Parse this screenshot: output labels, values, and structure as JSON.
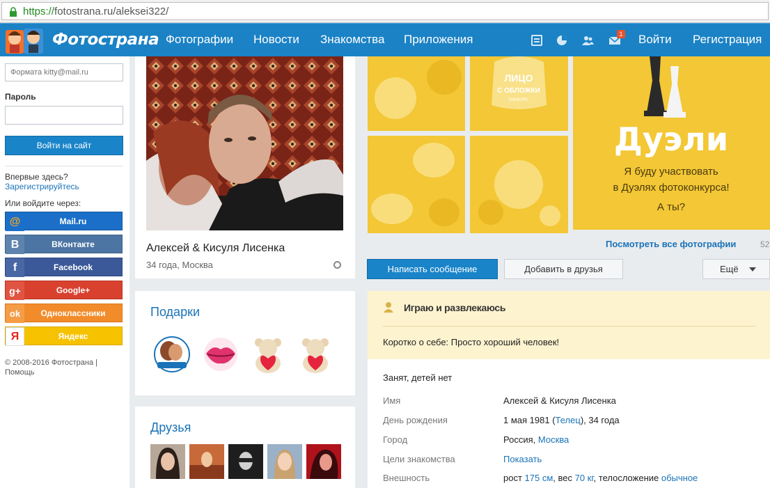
{
  "browser": {
    "url_scheme": "https://",
    "url_rest": "fotostrana.ru/aleksei322/"
  },
  "nav": {
    "logo_text": "Фотострана",
    "links": [
      "Фотографии",
      "Новости",
      "Знакомства",
      "Приложения"
    ],
    "icons": [
      "list-icon",
      "pie-icon",
      "people-icon",
      "mail-icon"
    ],
    "mail_badge": "1",
    "login": "Войти",
    "register": "Регистрация",
    "color": "#1b82c5"
  },
  "sidebar": {
    "email_placeholder": "Формата kitty@mail.ru",
    "password_label": "Пароль",
    "login_button": "Войти на сайт",
    "first_time": "Впервые здесь?",
    "register_link": "Зарегистрируйтесь",
    "or_login": "Или войдите через:",
    "social": [
      {
        "label": "Mail.ru",
        "icon": "@",
        "color": "#1b6fc8",
        "icon_bg": "#f5a623"
      },
      {
        "label": "ВКонтакте",
        "icon": "B",
        "color": "#4c75a3",
        "icon_bg": "#4c75a3"
      },
      {
        "label": "Facebook",
        "icon": "f",
        "color": "#3b5998",
        "icon_bg": "#3b5998"
      },
      {
        "label": "Google+",
        "icon": "g+",
        "color": "#d9412f",
        "icon_bg": "#d9412f"
      },
      {
        "label": "Одноклассники",
        "icon": "ok",
        "color": "#f28c2b",
        "icon_bg": "#f28c2b"
      },
      {
        "label": "Яндекс",
        "icon": "Я",
        "color": "#f6c200",
        "icon_bg": "#ffffff"
      }
    ],
    "copyright": "© 2008-2016 Фотострана | Помощь"
  },
  "profile": {
    "name": "Алексей & Кисуля Лисенка",
    "subtitle": "34 года, Москва"
  },
  "gifts": {
    "title": "Подарки",
    "items": [
      "badge-gift",
      "lips-gift",
      "bear-heart-gift",
      "bear-heart-gift"
    ]
  },
  "friends": {
    "title": "Друзья",
    "count": 5
  },
  "photos": {
    "promo_title": "Дуэли",
    "promo_text_1": "Я буду участвовать",
    "promo_text_2": "в Дуэлях фотоконкурса!",
    "promo_text_3": "А ты?",
    "cover_1": "ЛИЦО",
    "cover_2": "С ОБЛОЖКИ",
    "cover_3": "КОНКУРС",
    "see_all": "Посмотреть все фотографии",
    "count": "52"
  },
  "actions": {
    "write": "Написать сообщение",
    "add_friend": "Добавить в друзья",
    "more": "Ещё"
  },
  "info": {
    "status_title": "Играю и развлекаюсь",
    "about": "Коротко о себе: Просто хороший человек!",
    "marital": "Занят, детей нет",
    "name_label": "Имя",
    "name_value": "Алексей & Кисуля Лисенка",
    "bday_label": "День рождения",
    "bday_pre": "1 мая 1981 (",
    "bday_sign": "Телец",
    "bday_post": "), 34 года",
    "city_label": "Город",
    "city_pre": "Россия, ",
    "city_link": "Москва",
    "goals_label": "Цели знакомства",
    "goals_link": "Показать",
    "looks_label": "Внешность",
    "looks_pre": "рост ",
    "looks_height": "175 см",
    "looks_mid": ", вес ",
    "looks_weight": "70 кг",
    "looks_mid2": ", телосложение ",
    "looks_build": "обычное"
  }
}
